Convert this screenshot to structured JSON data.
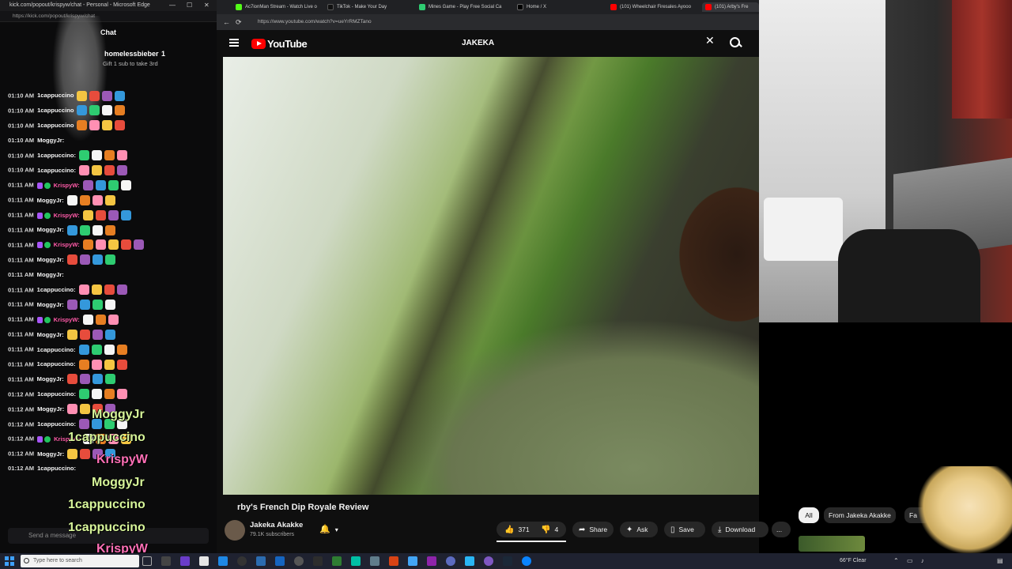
{
  "chat_window": {
    "title": "kick.com/popout/krispyw/chat - Personal - Microsoft Edge",
    "url": "https://kick.com/popout/krispyw/chat",
    "header": "Chat",
    "pinned": {
      "name": "homelessbieber",
      "count": "1",
      "subtitle": "Gift 1 sub to take 3rd"
    },
    "lines": [
      {
        "time": "01:10 AM",
        "user": "1cappuccino",
        "color": "#f5f5f5",
        "emotes": 4,
        "badge": ""
      },
      {
        "time": "01:10 AM",
        "user": "1cappuccino",
        "color": "#f5f5f5",
        "emotes": 4,
        "badge": ""
      },
      {
        "time": "01:10 AM",
        "user": "1cappuccino",
        "color": "#f5f5f5",
        "emotes": 4,
        "badge": ""
      },
      {
        "time": "01:10 AM",
        "user": "MoggyJr:",
        "color": "#f5f5f5",
        "emotes": 0,
        "badge": ""
      },
      {
        "time": "01:10 AM",
        "user": "1cappuccino:",
        "color": "#f5f5f5",
        "emotes": 4,
        "badge": ""
      },
      {
        "time": "01:10 AM",
        "user": "1cappuccino:",
        "color": "#f5f5f5",
        "emotes": 4,
        "badge": ""
      },
      {
        "time": "01:11 AM",
        "user": "KrispyW:",
        "color": "#ff5aa8",
        "emotes": 4,
        "badge": "mod"
      },
      {
        "time": "01:11 AM",
        "user": "MoggyJr:",
        "color": "#f5f5f5",
        "emotes": 4,
        "badge": ""
      },
      {
        "time": "01:11 AM",
        "user": "KrispyW:",
        "color": "#ff5aa8",
        "emotes": 4,
        "badge": "mod"
      },
      {
        "time": "01:11 AM",
        "user": "MoggyJr:",
        "color": "#f5f5f5",
        "emotes": 4,
        "badge": ""
      },
      {
        "time": "01:11 AM",
        "user": "KrispyW:",
        "color": "#ff5aa8",
        "emotes": 5,
        "badge": "mod"
      },
      {
        "time": "01:11 AM",
        "user": "MoggyJr:",
        "color": "#f5f5f5",
        "emotes": 4,
        "badge": ""
      },
      {
        "time": "01:11 AM",
        "user": "MoggyJr:",
        "color": "#f5f5f5",
        "emotes": 0,
        "badge": ""
      },
      {
        "time": "01:11 AM",
        "user": "1cappuccino:",
        "color": "#f5f5f5",
        "emotes": 4,
        "badge": ""
      },
      {
        "time": "01:11 AM",
        "user": "MoggyJr:",
        "color": "#f5f5f5",
        "emotes": 4,
        "badge": ""
      },
      {
        "time": "01:11 AM",
        "user": "KrispyW:",
        "color": "#ff5aa8",
        "emotes": 3,
        "badge": "mod"
      },
      {
        "time": "01:11 AM",
        "user": "MoggyJr:",
        "color": "#f5f5f5",
        "emotes": 4,
        "badge": ""
      },
      {
        "time": "01:11 AM",
        "user": "1cappuccino:",
        "color": "#f5f5f5",
        "emotes": 4,
        "badge": ""
      },
      {
        "time": "01:11 AM",
        "user": "1cappuccino:",
        "color": "#f5f5f5",
        "emotes": 4,
        "badge": ""
      },
      {
        "time": "01:11 AM",
        "user": "MoggyJr:",
        "color": "#f5f5f5",
        "emotes": 4,
        "badge": ""
      },
      {
        "time": "01:12 AM",
        "user": "1cappuccino:",
        "color": "#f5f5f5",
        "emotes": 4,
        "badge": ""
      },
      {
        "time": "01:12 AM",
        "user": "MoggyJr:",
        "color": "#f5f5f5",
        "emotes": 4,
        "badge": ""
      },
      {
        "time": "01:12 AM",
        "user": "1cappuccino:",
        "color": "#f5f5f5",
        "emotes": 4,
        "badge": ""
      },
      {
        "time": "01:12 AM",
        "user": "KrispyW:",
        "color": "#ff5aa8",
        "emotes": 4,
        "badge": "mod"
      },
      {
        "time": "01:12 AM",
        "user": "MoggyJr:",
        "color": "#f5f5f5",
        "emotes": 4,
        "badge": ""
      },
      {
        "time": "01:12 AM",
        "user": "1cappuccino:",
        "color": "#f5f5f5",
        "emotes": 0,
        "badge": ""
      }
    ],
    "overlay_names": [
      "MoggyJr",
      "1cappuccino",
      "KrispyW",
      "MoggyJr",
      "1cappuccino",
      "1cappuccino",
      "KrispyW"
    ],
    "input_placeholder": "Send a message"
  },
  "browser": {
    "tabs": [
      {
        "label": "Ac7ionMan Stream - Watch Live o",
        "color": "#53fc18"
      },
      {
        "label": "TikTok - Make Your Day",
        "color": "#111111"
      },
      {
        "label": "Mines Game - Play Free Social Ca",
        "color": "#2ecc71"
      },
      {
        "label": "Home / X",
        "color": "#000000"
      },
      {
        "label": "(101) Wheelchair Firesales Ayooo",
        "color": "#ff0000"
      },
      {
        "label": "(101) Arby's Fre",
        "color": "#ff0000"
      }
    ],
    "url": "https://www.youtube.com/watch?v=ueYrRMZTano"
  },
  "youtube": {
    "logo_text": "YouTube",
    "search_value": "JAKEKA",
    "video_title": "rby's French Dip Royale Review",
    "channel_name": "Jakeka Akakke",
    "subscribers": "79.1K subscribers",
    "likes": "371",
    "dislikes": "4",
    "share_label": "Share",
    "ask_label": "Ask",
    "save_label": "Save",
    "download_label": "Download",
    "more_label": "...",
    "chips": [
      "All",
      "From Jakeka Akakke",
      "Fa"
    ]
  },
  "taskbar": {
    "search_placeholder": "Type here to search",
    "weather": "66°F Clear"
  },
  "colors": {
    "kick_green": "#53fc18",
    "yt_red": "#ff0000",
    "pink_name": "#ff5aa8",
    "overlay_name": "#d7f59a"
  }
}
